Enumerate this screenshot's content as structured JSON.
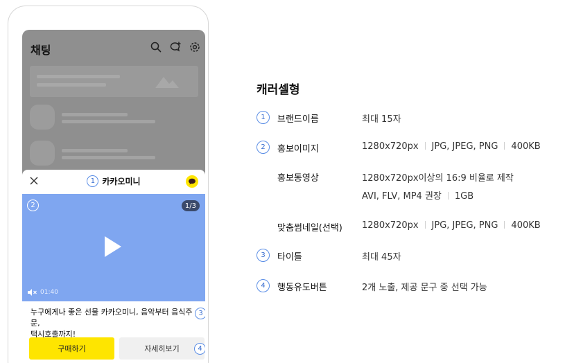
{
  "phone": {
    "chat_title": "채팅",
    "header_icons": [
      "search-icon",
      "new-chat-icon",
      "settings-icon"
    ],
    "ad_card": {
      "brand_badge": "1",
      "brand_name": "카카오미니",
      "media_badge": "2",
      "page_count": "1/3",
      "duration": "01:40",
      "title_line1": "누구에게나 좋은 선물 카카오미니, 음악부터 음식주문,",
      "title_line2": "택시호출까지!",
      "title_badge": "3",
      "buy_label": "구매하기",
      "detail_label": "자세히보기",
      "cta_badge": "4"
    }
  },
  "spec": {
    "title": "캐러셀형",
    "rows": [
      {
        "badge": "1",
        "label": "브랜드이름",
        "values": [
          "최대 15자"
        ]
      },
      {
        "badge": "2",
        "label": "홍보이미지",
        "values": [
          "1280x720px",
          "JPG, JPEG, PNG",
          "400KB"
        ]
      },
      {
        "badge": "",
        "label": "홍보동영상",
        "line1": "1280x720px이상의 16:9 비율로 제작",
        "values2": [
          "AVI, FLV, MP4 권장",
          "1GB"
        ]
      },
      {
        "badge": "",
        "label": "맞춤썸네일(선택)",
        "values": [
          "1280x720px",
          "JPG, JPEG, PNG",
          "400KB"
        ]
      },
      {
        "badge": "3",
        "label": "타이틀",
        "values": [
          "최대 45자"
        ]
      },
      {
        "badge": "4",
        "label": "행동유도버튼",
        "values": [
          "2개 노출, 제공 문구 중 선택 가능"
        ]
      }
    ]
  },
  "colors": {
    "accent_yellow": "#fee500",
    "media_blue": "#7fa6f0",
    "badge_blue": "#3a6fd0",
    "overlay_gray": "#8f8f8f"
  }
}
